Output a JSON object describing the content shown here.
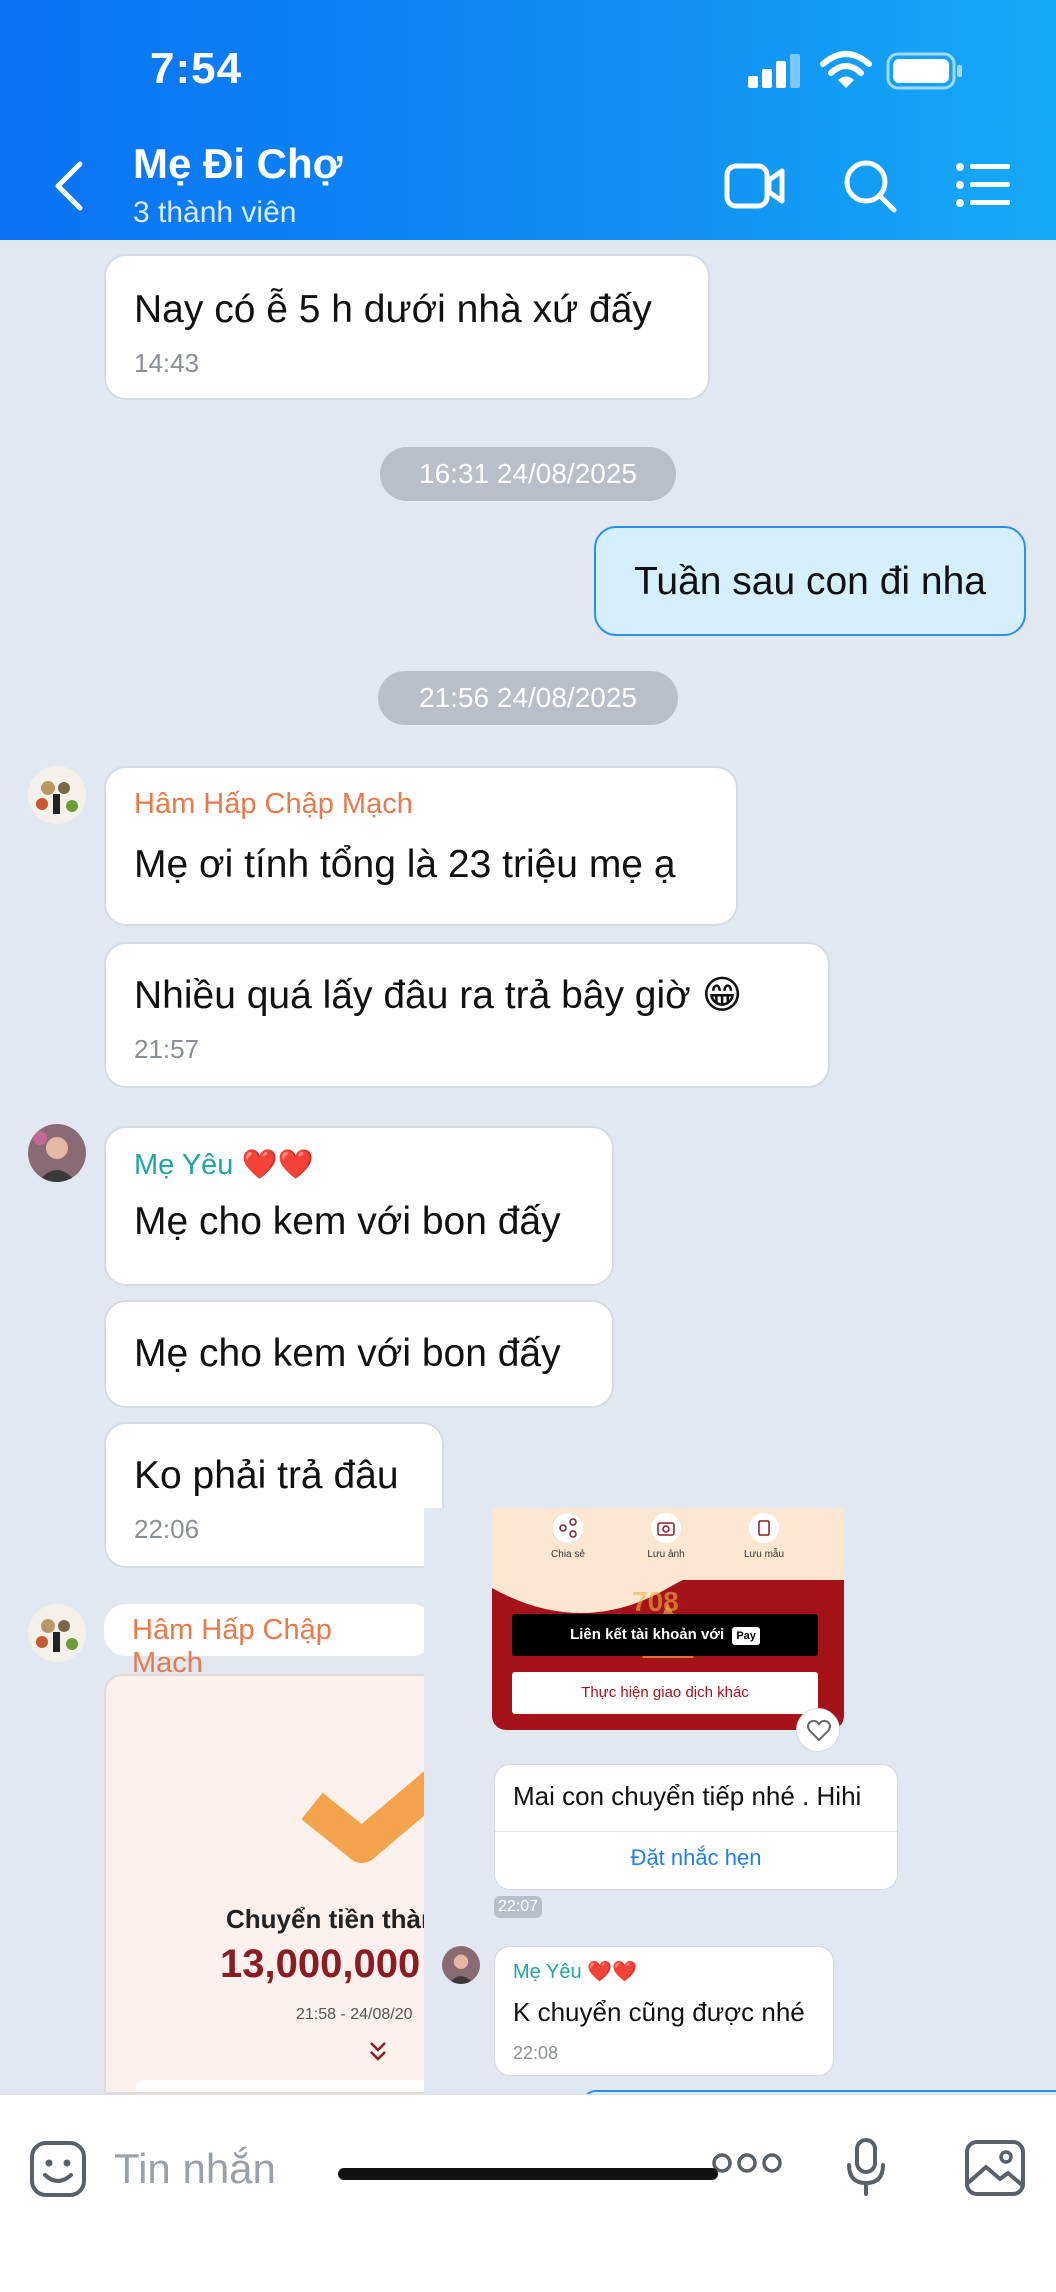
{
  "status_bar": {
    "time": "7:54"
  },
  "header": {
    "title": "Mẹ Đi Chợ",
    "subtitle": "3 thành viên"
  },
  "messages": {
    "m1": {
      "text": "Nay có ễ  5 h dưới nhà xứ đấy",
      "time": "14:43"
    },
    "sep1": "16:31 24/08/2025",
    "m2": {
      "text": "Tuần sau con đi nha"
    },
    "sep2": "21:56 24/08/2025",
    "m3": {
      "sender": "Hâm Hấp Chập Mạch",
      "text": "Mẹ ơi tính tổng là 23 triệu mẹ ạ"
    },
    "m4": {
      "text": "Nhiều quá lấy đâu ra trả  bây giờ 😁",
      "time": "21:57"
    },
    "m5": {
      "sender": "Mẹ Yêu ❤️❤️",
      "text": "Mẹ cho kem với bon đấy"
    },
    "m6": {
      "text": "Mẹ cho kem với bon đấy"
    },
    "m7": {
      "text": "Ko phải trả đâu",
      "time": "22:06"
    },
    "m8": {
      "sender": "Hâm Hấp Chập Mạch"
    },
    "receipt": {
      "title": "Chuyển tiền thàn",
      "amount": "13,000,000",
      "datetime": "21:58 - 24/08/20"
    }
  },
  "overlay": {
    "actions": [
      "Chia sẻ",
      "Lưu ảnh",
      "Lưu mẫu"
    ],
    "banner_text": "708",
    "link_button": "Liên kết tài khoản với",
    "pay_badge": " Pay",
    "other_tx_button": "Thực hiện giao dịch khác",
    "msg1": "Mai con chuyển tiếp nhé . Hihi",
    "reminder": "Đặt nhắc hẹn",
    "time1": "22:07",
    "sender2": "Mẹ Yêu ❤️❤️",
    "msg2": "K chuyển cũng được nhé",
    "time2": "22:08"
  },
  "composer": {
    "placeholder": "Tin nhắn"
  },
  "colors": {
    "header_blue": "#0b7cf4",
    "sender_orange": "#e8794a",
    "sender_teal": "#1fa6a4",
    "sent_bubble": "#d5efff",
    "chat_bg": "#e2e8f1"
  }
}
